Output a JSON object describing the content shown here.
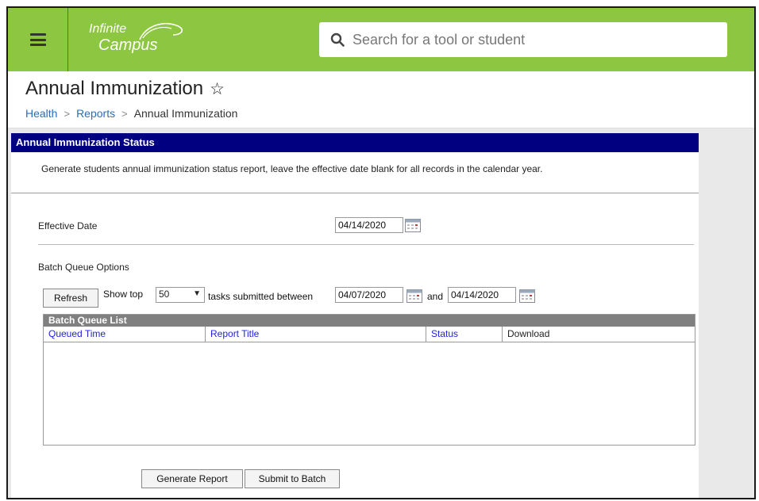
{
  "header": {
    "menu_icon": "hamburger-menu-icon",
    "logo_line1": "Infinite",
    "logo_line2": "Campus",
    "search_placeholder": "Search for a tool or student",
    "accent_color": "#8dc641"
  },
  "page": {
    "title": "Annual Immunization",
    "breadcrumb": [
      "Health",
      "Reports",
      "Annual Immunization"
    ]
  },
  "panel": {
    "header": "Annual Immunization Status",
    "header_color": "#000080",
    "description": "Generate students annual immunization status report, leave the effective date blank for all records in the calendar year.",
    "effective_date_label": "Effective Date",
    "effective_date_value": "04/14/2020",
    "batch_queue_options_label": "Batch Queue Options"
  },
  "batch": {
    "refresh_label": "Refresh",
    "show_top_label": "Show top",
    "show_top_value": "50",
    "between_label": "tasks submitted between",
    "start_date": "04/07/2020",
    "and_label": "and",
    "end_date": "04/14/2020",
    "list_title": "Batch Queue List",
    "columns": [
      "Queued Time",
      "Report Title",
      "Status",
      "Download"
    ]
  },
  "actions": {
    "generate_label": "Generate Report",
    "submit_label": "Submit to Batch"
  }
}
